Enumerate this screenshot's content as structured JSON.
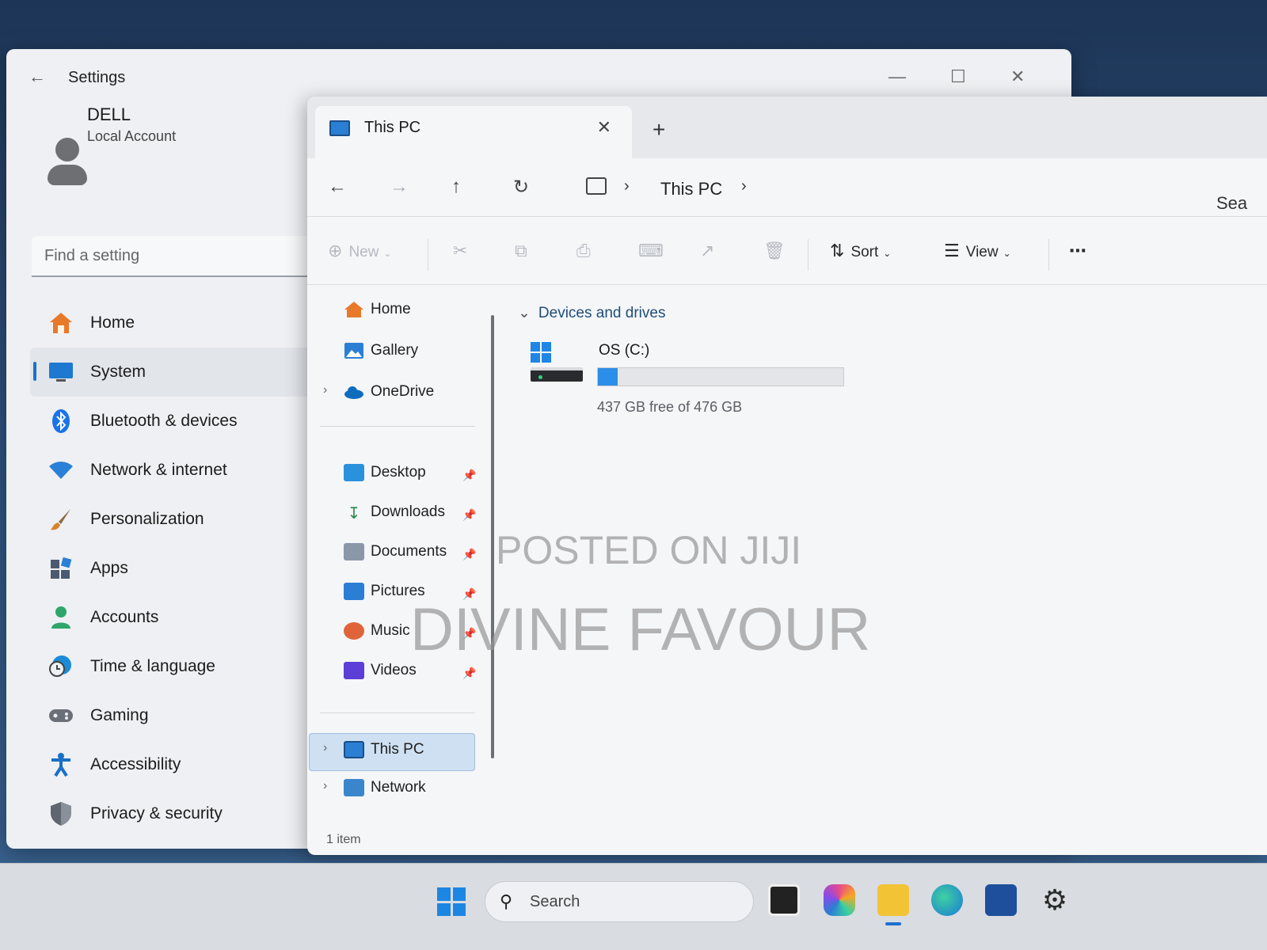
{
  "settings": {
    "title": "Settings",
    "account": {
      "name": "DELL",
      "type": "Local Account"
    },
    "search_placeholder": "Find a setting",
    "nav": [
      {
        "label": "Home",
        "icon": "home-icon",
        "color": "#e8792b"
      },
      {
        "label": "System",
        "icon": "system-icon",
        "color": "#1e78d0",
        "selected": true
      },
      {
        "label": "Bluetooth & devices",
        "icon": "bluetooth-icon",
        "color": "#1a73e8"
      },
      {
        "label": "Network & internet",
        "icon": "wifi-icon",
        "color": "#2a7fd6"
      },
      {
        "label": "Personalization",
        "icon": "brush-icon",
        "color": "#d9822b"
      },
      {
        "label": "Apps",
        "icon": "apps-icon",
        "color": "#4a5a70"
      },
      {
        "label": "Accounts",
        "icon": "accounts-icon",
        "color": "#2fa56a"
      },
      {
        "label": "Time & language",
        "icon": "clock-globe-icon",
        "color": "#1c8ad6"
      },
      {
        "label": "Gaming",
        "icon": "gamepad-icon",
        "color": "#6b6f77"
      },
      {
        "label": "Accessibility",
        "icon": "accessibility-icon",
        "color": "#1a6fc6"
      },
      {
        "label": "Privacy & security",
        "icon": "shield-icon",
        "color": "#5f6670"
      }
    ]
  },
  "explorer": {
    "tab_label": "This PC",
    "breadcrumb": "This PC",
    "search_partial": "Sea",
    "toolbar": {
      "new_label": "New",
      "sort_label": "Sort",
      "view_label": "View"
    },
    "sidebar": {
      "quick": [
        {
          "label": "Home",
          "icon": "home-icon"
        },
        {
          "label": "Gallery",
          "icon": "gallery-icon"
        },
        {
          "label": "OneDrive",
          "icon": "onedrive-icon"
        }
      ],
      "pinned": [
        {
          "label": "Desktop",
          "icon": "desktop-icon"
        },
        {
          "label": "Downloads",
          "icon": "downloads-icon"
        },
        {
          "label": "Documents",
          "icon": "documents-icon"
        },
        {
          "label": "Pictures",
          "icon": "pictures-icon"
        },
        {
          "label": "Music",
          "icon": "music-icon"
        },
        {
          "label": "Videos",
          "icon": "videos-icon"
        }
      ],
      "locations": [
        {
          "label": "This PC",
          "icon": "this-pc-icon",
          "selected": true
        },
        {
          "label": "Network",
          "icon": "network-icon"
        }
      ]
    },
    "group_header": "Devices and drives",
    "drive": {
      "name": "OS (C:)",
      "free_text": "437 GB free of 476 GB",
      "used_fraction": 0.08
    },
    "status": "1 item"
  },
  "watermark": {
    "line1": "POSTED ON JIJI",
    "line2": "DIVINE FAVOUR"
  },
  "taskbar": {
    "search_label": "Search"
  }
}
